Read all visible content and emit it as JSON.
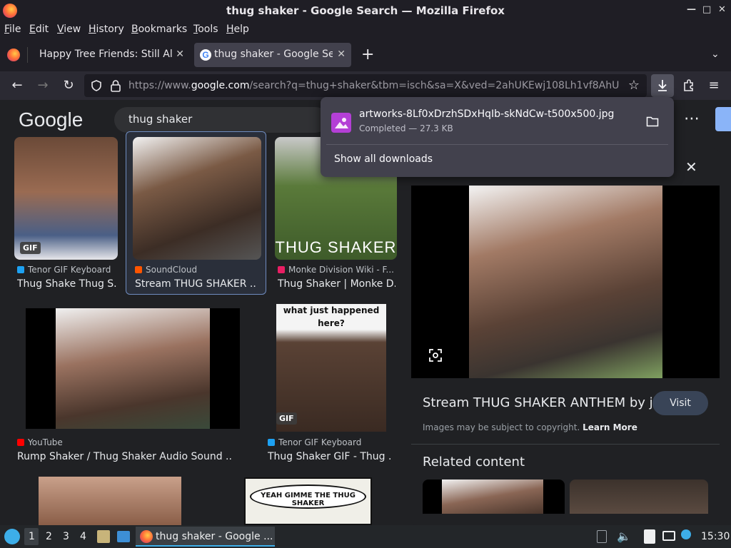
{
  "window": {
    "title": "thug shaker - Google Search — Mozilla Firefox",
    "min_icon": "minimize-icon",
    "max_icon": "maximize-icon",
    "close_icon": "close-icon"
  },
  "menu": {
    "items": [
      {
        "label": "File",
        "accel": "F"
      },
      {
        "label": "Edit",
        "accel": "E"
      },
      {
        "label": "View",
        "accel": "V"
      },
      {
        "label": "History",
        "accel": "H"
      },
      {
        "label": "Bookmarks",
        "accel": "B"
      },
      {
        "label": "Tools",
        "accel": "T"
      },
      {
        "label": "Help",
        "accel": "H"
      }
    ]
  },
  "tabs": [
    {
      "label": "Happy Tree Friends: Still Aliv",
      "active": false
    },
    {
      "label": "thug shaker - Google Sea",
      "active": true
    }
  ],
  "new_tab_label": "+",
  "urlbar": {
    "prefix": "https://www.",
    "domain": "google.com",
    "rest": "/search?q=thug+shaker&tbm=isch&sa=X&ved=2ahUKEwj108Lh1vf8AhU"
  },
  "google": {
    "logo": "Google",
    "query": "thug shaker"
  },
  "downloads": {
    "filename": "artworks-8Lf0xDrzhSDxHqIb-skNdCw-t500x500.jpg",
    "status": "Completed — 27.3 KB",
    "show_all": "Show all downloads"
  },
  "results": [
    {
      "source": "Tenor GIF Keyboard",
      "caption": "Thug Shake Thug S...",
      "badge": "GIF",
      "src_color": "#1da1f2"
    },
    {
      "source": "SoundCloud",
      "caption": "Stream THUG SHAKER ...",
      "src_color": "#ff5500"
    },
    {
      "source": "Monke Division Wiki - F...",
      "caption": "Thug Shaker | Monke D...",
      "overlay": "THUG SHAKER",
      "src_color": "#e91e63"
    },
    {
      "source": "YouTube",
      "caption": "Rump Shaker / Thug Shaker Audio Sound ...",
      "src_color": "#ff0000"
    },
    {
      "source": "Tenor GIF Keyboard",
      "caption": "Thug Shaker GIF - Thug ...",
      "badge": "GIF",
      "overlay": "what just happened here?",
      "src_color": "#1da1f2"
    },
    {
      "overlay": "YEAH GIMME THE THUG SHAKER"
    }
  ],
  "preview": {
    "title": "Stream THUG SHAKER ANTHEM by ji...",
    "visit": "Visit",
    "copyright": "Images may be subject to copyright.",
    "learn_more": "Learn More",
    "related": "Related content"
  },
  "taskbar": {
    "workspaces": [
      "1",
      "2",
      "3",
      "4"
    ],
    "task_label": "thug shaker - Google ...",
    "clock": "15:30"
  },
  "colors": {
    "chrome_bg": "#1f1e25",
    "toolbar_bg": "#2b2a33",
    "page_bg": "#202124",
    "panel_bg": "#42414d",
    "accent_blue": "#8ab4f8"
  }
}
